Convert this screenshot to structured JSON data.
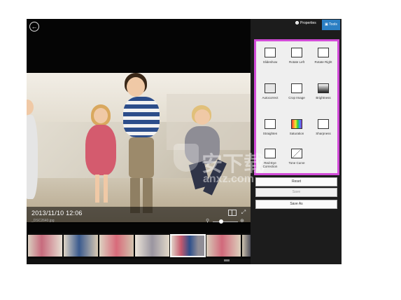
{
  "viewer": {
    "date": "2013/11/10 12:06",
    "filename": "_DSC2640.jpg"
  },
  "tabs": {
    "properties": "Properties",
    "tools": "Tools"
  },
  "tools": [
    {
      "label": "Slideshow",
      "icon": "slideshow-icon"
    },
    {
      "label": "Rotate Left",
      "icon": "rotate-left-icon"
    },
    {
      "label": "Rotate Right",
      "icon": "rotate-right-icon"
    },
    {
      "label": "Autocorrect",
      "icon": "autocorrect-icon"
    },
    {
      "label": "Crop Image",
      "icon": "crop-icon"
    },
    {
      "label": "Brightness",
      "icon": "brightness-icon"
    },
    {
      "label": "Straighten",
      "icon": "straighten-icon"
    },
    {
      "label": "Saturation",
      "icon": "saturation-icon"
    },
    {
      "label": "Sharpness",
      "icon": "sharpness-icon"
    },
    {
      "label": "Red-Eye Correction",
      "icon": "red-eye-icon"
    },
    {
      "label": "Tone Curve",
      "icon": "tone-curve-icon"
    }
  ],
  "buttons": {
    "reset": "Reset",
    "save": "Save",
    "save_as": "Save As"
  },
  "watermark": {
    "main": "安下载",
    "sub": "anxz.com"
  },
  "colors": {
    "accent": "#2b7fc3",
    "highlight": "#d24bd8"
  }
}
